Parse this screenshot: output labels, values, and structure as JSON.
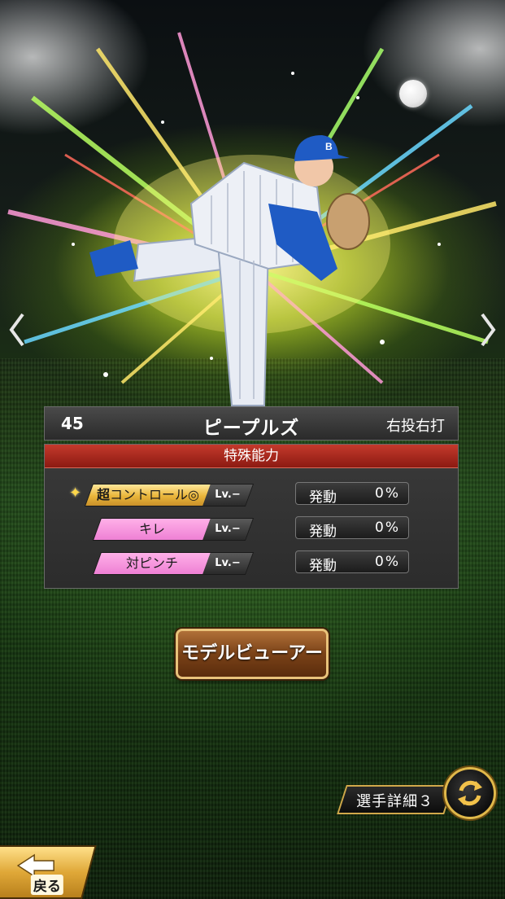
{
  "player": {
    "number": "45",
    "name": "ピープルズ",
    "throws_bats": "右投右打"
  },
  "special_abilities": {
    "header": "特殊能力",
    "items": [
      {
        "prefix_icon": "sparkle-icon",
        "prefix": "超",
        "name": "コントロール◎",
        "style": "gold",
        "level": "Lv.−",
        "activation_label": "発動",
        "activation_value": "0%"
      },
      {
        "name": "キレ",
        "style": "pink",
        "level": "Lv.−",
        "activation_label": "発動",
        "activation_value": "0%"
      },
      {
        "name": "対ピンチ",
        "style": "pink",
        "level": "Lv.−",
        "activation_label": "発動",
        "activation_value": "0%"
      }
    ]
  },
  "buttons": {
    "model_viewer": "モデルビューアー",
    "player_detail": "選手詳細３",
    "back": "戻る"
  },
  "colors": {
    "ability_header": "#b02a1e",
    "gold_skill": "#e9b53a",
    "pink_skill": "#ee80d4",
    "button_border": "#e8c27a",
    "team_blue": "#1f5bc4"
  }
}
